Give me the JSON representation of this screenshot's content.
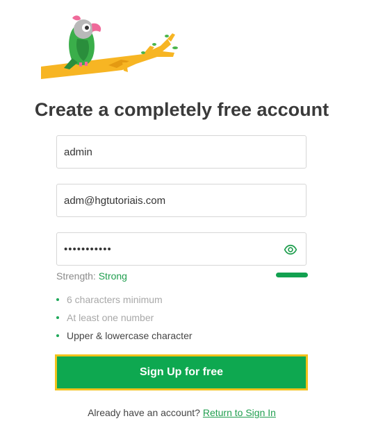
{
  "page": {
    "title": "Create a completely free account"
  },
  "form": {
    "username_value": "admin",
    "email_value": "adm@hgtutoriais.com",
    "password_value": "•••••••••••",
    "strength_label": "Strength:",
    "strength_value": "Strong",
    "strength_level": 1.0,
    "rules": [
      {
        "text": "6 characters minimum",
        "met": false
      },
      {
        "text": "At least one number",
        "met": false
      },
      {
        "text": "Upper & lowercase character",
        "met": true
      }
    ],
    "submit_label": "Sign Up for free"
  },
  "footer": {
    "prompt": "Already have an account?",
    "link_label": "Return to Sign In"
  },
  "icons": {
    "logo": "parrot-on-branch-logo",
    "password_toggle": "eye-icon"
  },
  "colors": {
    "accent_green": "#0ea850",
    "focus_outline": "#f2c21b",
    "strength_green": "#12a150"
  }
}
